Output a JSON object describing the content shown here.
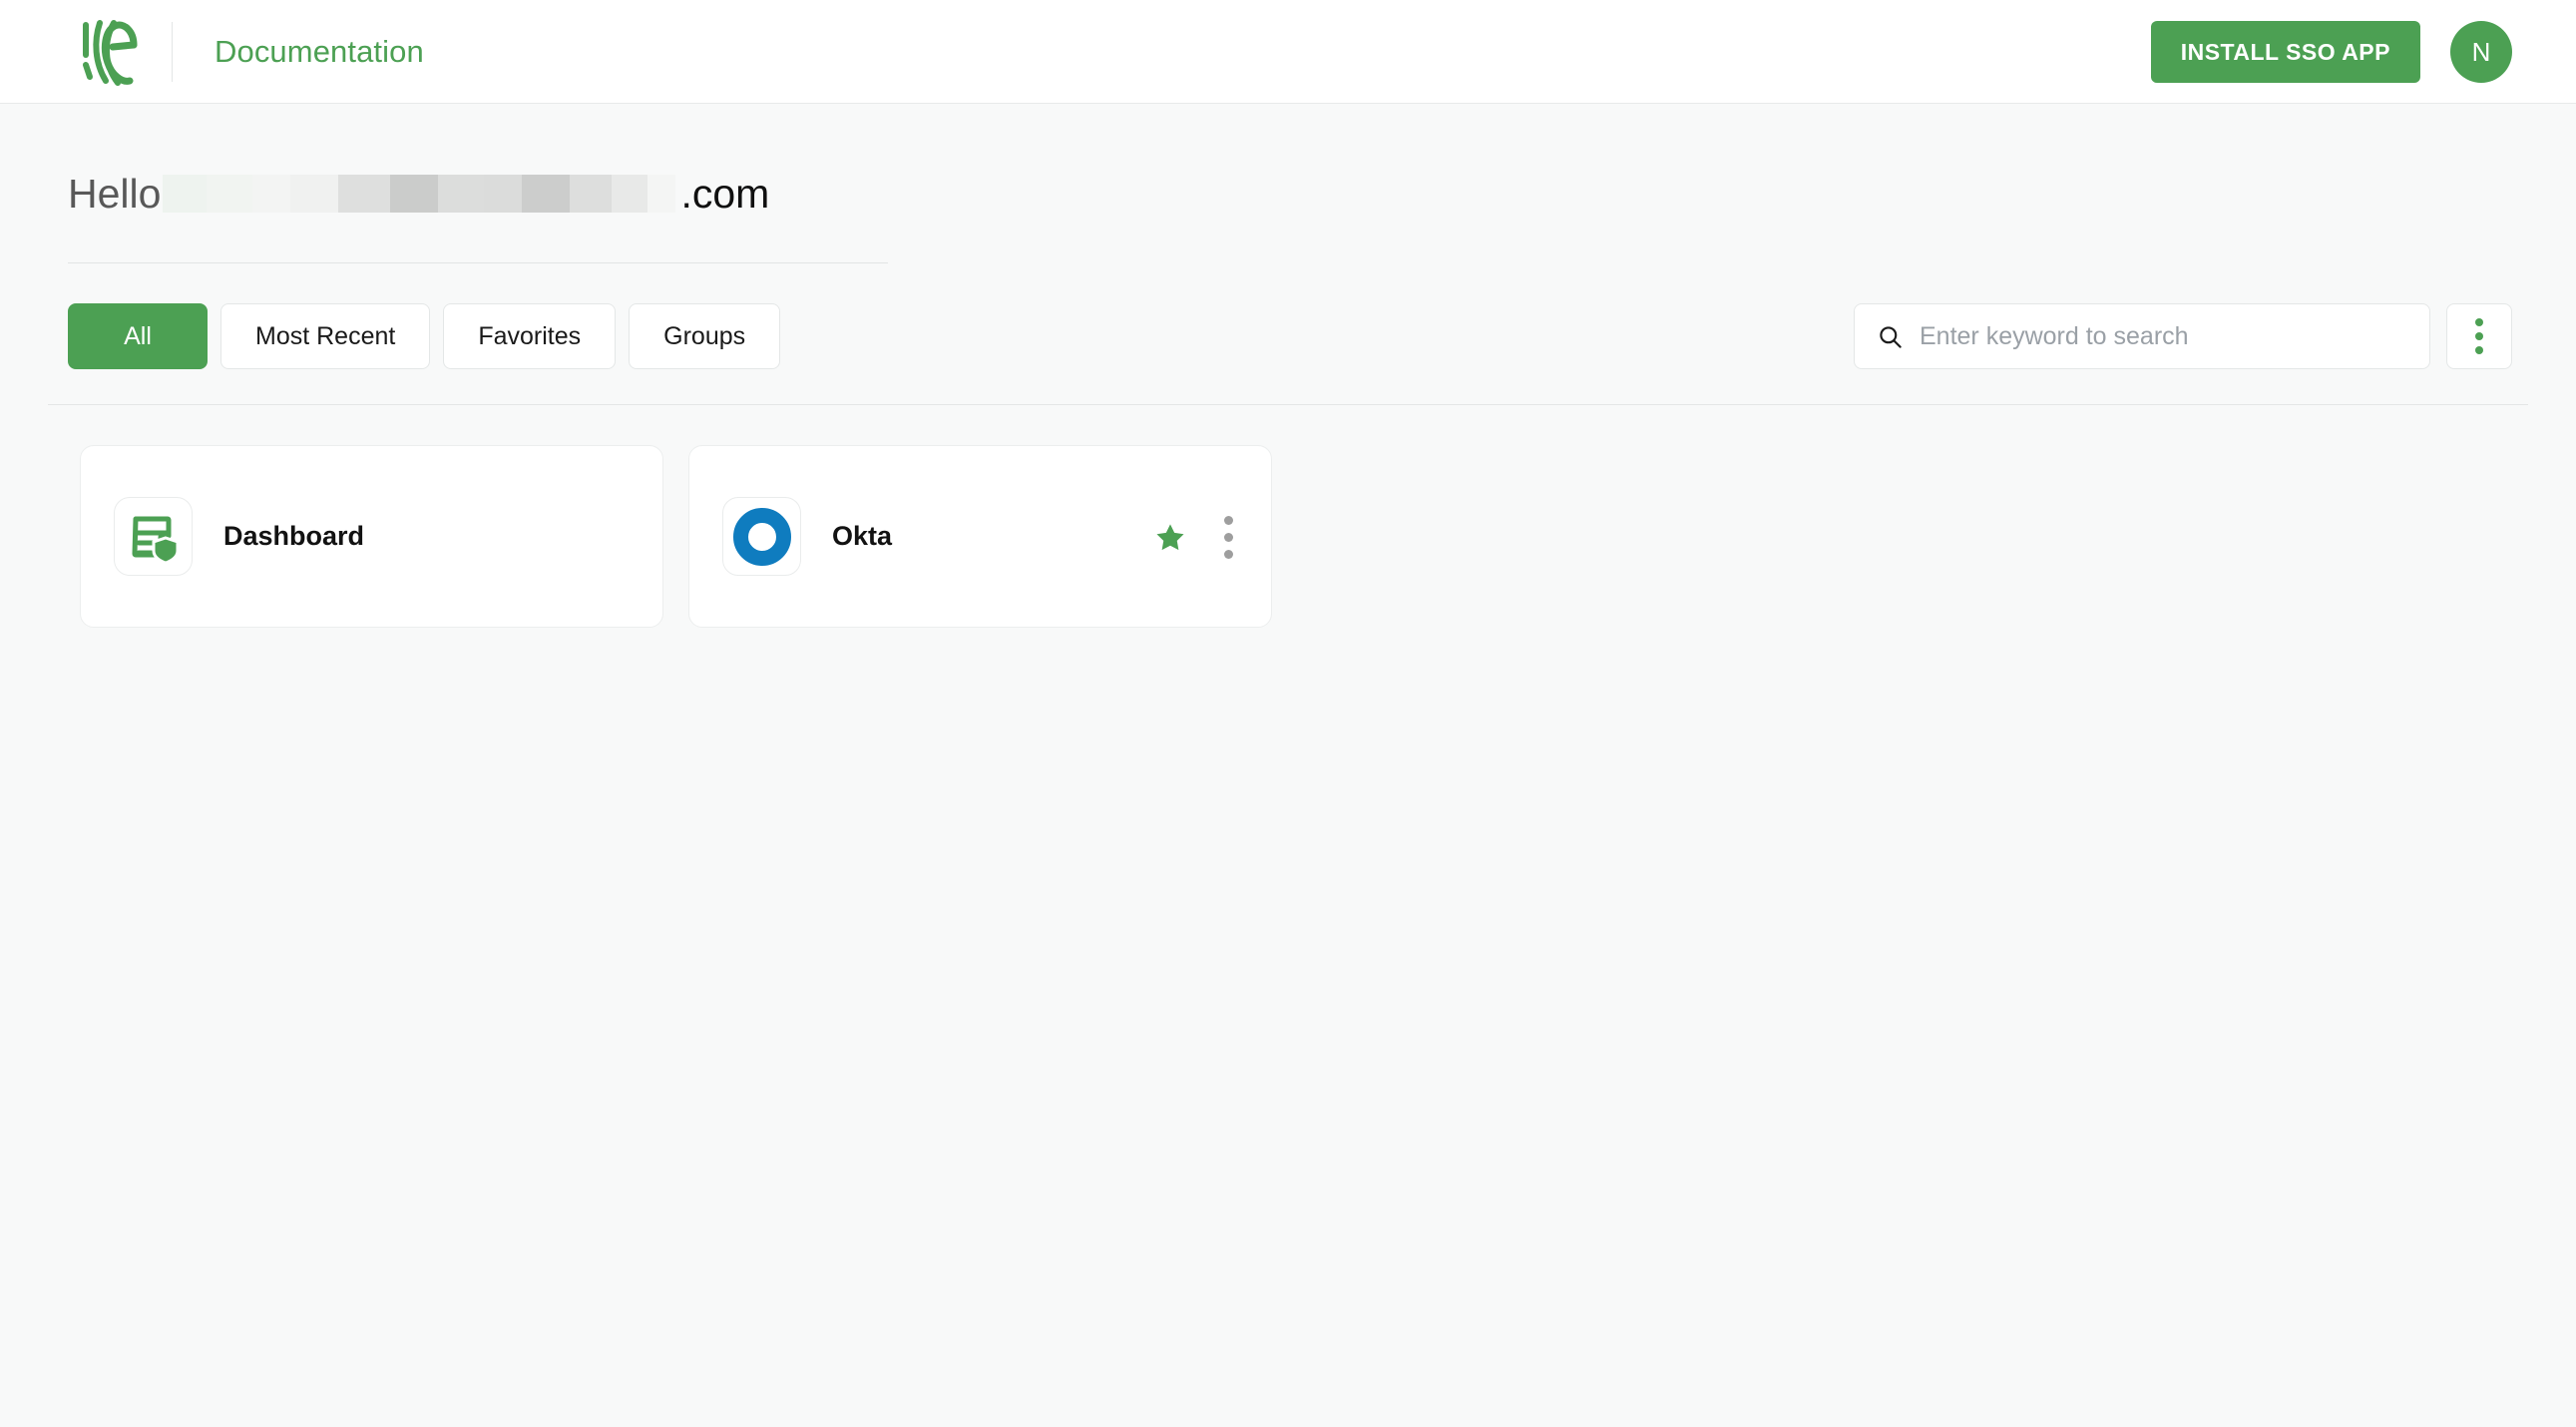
{
  "topbar": {
    "logo_icon": "ellie-logo-icon",
    "title": "Documentation",
    "install_button_label": "INSTALL SSO APP",
    "avatar_initial": "N"
  },
  "greeting": {
    "hello_label": "Hello",
    "redacted": true,
    "tld_label": ".com"
  },
  "filters": {
    "tabs": [
      {
        "label": "All",
        "active": true
      },
      {
        "label": "Most Recent",
        "active": false
      },
      {
        "label": "Favorites",
        "active": false
      },
      {
        "label": "Groups",
        "active": false
      }
    ],
    "search": {
      "placeholder": "Enter keyword to search",
      "value": "",
      "icon": "search-icon"
    },
    "overflow_menu_icon": "kebab-menu-icon"
  },
  "apps": [
    {
      "name": "Dashboard",
      "icon": "dashboard-shield-icon",
      "icon_color": "#4CA053",
      "favorite": false,
      "has_menu": false
    },
    {
      "name": "Okta",
      "icon": "okta-ring-icon",
      "icon_color": "#0F7CBF",
      "favorite": true,
      "has_menu": true
    }
  ],
  "colors": {
    "brand_green": "#4CA053",
    "okta_blue": "#0F7CBF",
    "star_green": "#4CA053",
    "page_background": "#f8f9f9",
    "card_background": "#ffffff",
    "border": "#e4e7e7"
  }
}
